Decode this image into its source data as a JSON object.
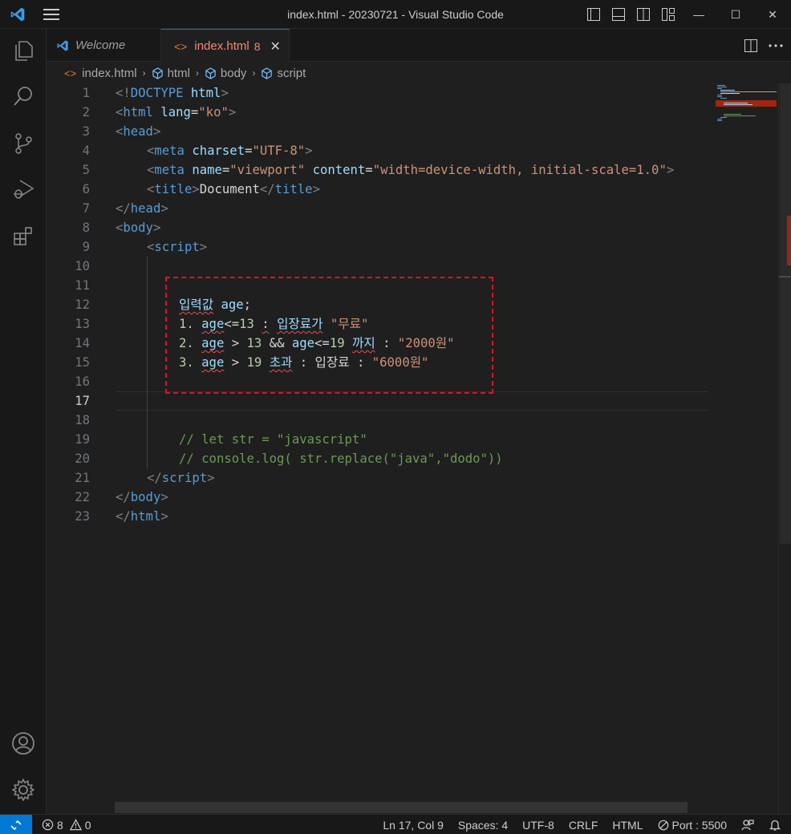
{
  "window": {
    "title": "index.html - 20230721 - Visual Studio Code",
    "minimize": "—",
    "maximize": "☐",
    "close": "✕"
  },
  "tabs": [
    {
      "label": "Welcome",
      "icon": "vscode-logo-icon"
    },
    {
      "label": "index.html",
      "badge": "8",
      "close": "✕",
      "icon": "html-file-icon"
    }
  ],
  "breadcrumb": [
    "index.html",
    "html",
    "body",
    "script"
  ],
  "editor": {
    "current_line": "17",
    "lines": [
      {
        "n": "1"
      },
      {
        "n": "2"
      },
      {
        "n": "3"
      },
      {
        "n": "4"
      },
      {
        "n": "5"
      },
      {
        "n": "6"
      },
      {
        "n": "7"
      },
      {
        "n": "8"
      },
      {
        "n": "9"
      },
      {
        "n": "10"
      },
      {
        "n": "11"
      },
      {
        "n": "12"
      },
      {
        "n": "13"
      },
      {
        "n": "14"
      },
      {
        "n": "15"
      },
      {
        "n": "16"
      },
      {
        "n": "17"
      },
      {
        "n": "18"
      },
      {
        "n": "19"
      },
      {
        "n": "20"
      },
      {
        "n": "21"
      },
      {
        "n": "22"
      },
      {
        "n": "23"
      }
    ],
    "code": {
      "l1": {
        "a": "<!",
        "b": "DOCTYPE",
        "c": " html",
        "d": ">"
      },
      "l2": {
        "a": "<",
        "b": "html",
        "c": " lang",
        "d": "=",
        "e": "\"ko\"",
        "f": ">"
      },
      "l3": {
        "a": "<",
        "b": "head",
        "c": ">"
      },
      "l4": {
        "a": "<",
        "b": "meta",
        "c": " charset",
        "d": "=",
        "e": "\"UTF-8\"",
        "f": ">"
      },
      "l5": {
        "a": "<",
        "b": "meta",
        "c": " name",
        "d": "=",
        "e": "\"viewport\"",
        "f": " content",
        "g": "=",
        "h": "\"width=device-width, initial-scale=1.0\"",
        "i": ">"
      },
      "l6": {
        "a": "<",
        "b": "title",
        "c": ">",
        "d": "Document",
        "e": "</",
        "f": "title",
        "g": ">"
      },
      "l7": {
        "a": "</",
        "b": "head",
        "c": ">"
      },
      "l8": {
        "a": "<",
        "b": "body",
        "c": ">"
      },
      "l9": {
        "a": "<",
        "b": "script",
        "c": ">"
      },
      "l12": {
        "a": "입력값",
        "b": " ",
        "c": "age",
        "d": ";"
      },
      "l13": {
        "a": "1. ",
        "b": "age",
        "c": "<=",
        "d": "13",
        "e": " ",
        "f": ":",
        "g": " ",
        "h": "입장료가",
        "i": " ",
        "j": "\"무료\""
      },
      "l14": {
        "a": "2. ",
        "b": "age",
        "c": " > ",
        "d": "13",
        "e": " && ",
        "f": "age",
        "g": "<=",
        "h": "19",
        "i": " ",
        "j": "까지",
        "k": " : ",
        "l": "\"2000원\""
      },
      "l15": {
        "a": "3. ",
        "b": "age",
        "c": " > ",
        "d": "19",
        "e": " ",
        "f": "초과",
        "g": " : 입장료 : ",
        "h": "\"6000원\""
      },
      "l19": "// let str = \"javascript\"",
      "l20": "// console.log( str.replace(\"java\",\"dodo\"))",
      "l21": {
        "a": "</",
        "b": "script",
        "c": ">"
      },
      "l22": {
        "a": "</",
        "b": "body",
        "c": ">"
      },
      "l23": {
        "a": "</",
        "b": "html",
        "c": ">"
      }
    }
  },
  "statusbar": {
    "errors": "8",
    "warnings": "0",
    "position": "Ln 17, Col 9",
    "spaces": "Spaces: 4",
    "encoding": "UTF-8",
    "eol": "CRLF",
    "language": "HTML",
    "port": "Port : 5500"
  },
  "colors": {
    "accent": "#0078d4",
    "error": "#f14c4c",
    "annotation_box": "#e0111f"
  }
}
